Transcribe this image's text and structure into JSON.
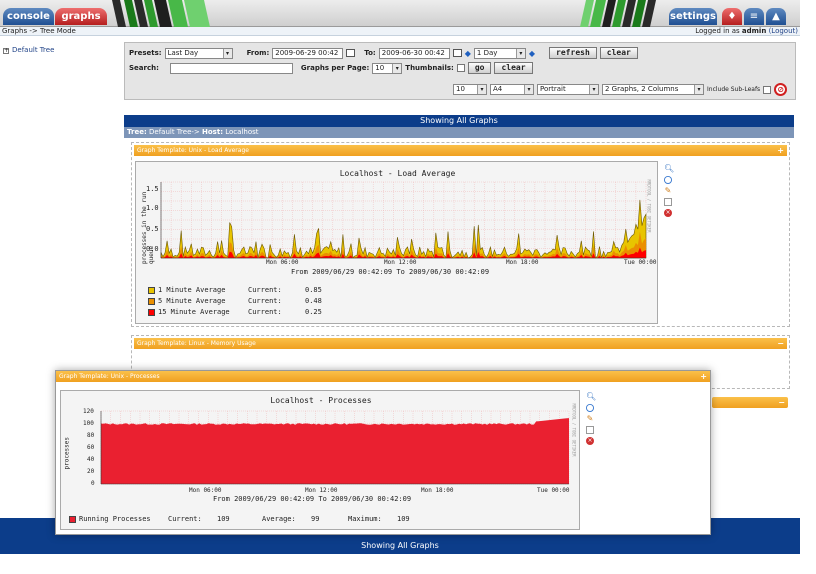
{
  "tabs": {
    "console": "console",
    "graphs": "graphs",
    "settings": "settings"
  },
  "breadcrumb": "Graphs -> Tree Mode",
  "login": {
    "prefix": "Logged in as",
    "user": "admin",
    "logout": "(Logout)"
  },
  "tree": {
    "root_toggle": "+",
    "root_label": "Default Tree"
  },
  "filter": {
    "presets_label": "Presets:",
    "presets_value": "Last Day",
    "from_label": "From:",
    "from_value": "2009-06-29 00:42",
    "to_label": "To:",
    "to_value": "2009-06-30 00:42",
    "timespan_value": "1 Day",
    "refresh_label": "refresh",
    "clear_label": "clear",
    "search_label": "Search:",
    "search_value": "",
    "graphs_per_page_label": "Graphs per Page:",
    "graphs_per_page_value": "10",
    "thumbnails_label": "Thumbnails:",
    "go_label": "go",
    "clear2_label": "clear",
    "pdf_count": "10",
    "pdf_paper": "A4",
    "pdf_orientation": "Portrait",
    "pdf_layout": "2 Graphs, 2 Columns",
    "include_subleafs_label": "Include Sub-Leafs"
  },
  "showing_all": "Showing All Graphs",
  "tree_host": {
    "tree_label": "Tree:",
    "tree_value": "Default Tree->",
    "host_label": "Host:",
    "host_value": "Localhost"
  },
  "panels": {
    "load": {
      "title": "Graph Template: Unix - Load Average"
    },
    "memory": {
      "title": "Graph Template: Linux - Memory Usage"
    },
    "processes": {
      "title": "Graph Template: Unix - Processes"
    }
  },
  "load_graph": {
    "title": "Localhost - Load Average",
    "ylabel": "processes in the run queue",
    "yticks": [
      "1.5",
      "1.0",
      "0.5",
      "0.0"
    ],
    "xticks": [
      "Mon 06:00",
      "Mon 12:00",
      "Mon 18:00",
      "Tue 00:00"
    ],
    "range": "From 2009/06/29 00:42:09 To 2009/06/30 00:42:09",
    "side_label": "RRDTOOL / TOBI OETIKER",
    "legend": [
      {
        "label": "1 Minute Average",
        "current_label": "Current:",
        "current": "0.85",
        "color": "#e8c400"
      },
      {
        "label": "5 Minute Average",
        "current_label": "Current:",
        "current": "0.48",
        "color": "#ea8f00"
      },
      {
        "label": "15 Minute Average",
        "current_label": "Current:",
        "current": "0.25",
        "color": "#ff0000"
      }
    ]
  },
  "proc_graph": {
    "title": "Localhost - Processes",
    "ylabel": "processes",
    "yticks": [
      "120",
      "100",
      "80",
      "60",
      "40",
      "20",
      "0"
    ],
    "xticks": [
      "Mon 06:00",
      "Mon 12:00",
      "Mon 18:00",
      "Tue 00:00"
    ],
    "range": "From 2009/06/29 00:42:09 To 2009/06/30 00:42:09",
    "side_label": "RRDTOOL / TOBI OETIKER",
    "legend": {
      "label": "Running Processes",
      "current_label": "Current:",
      "current": "109",
      "average_label": "Average:",
      "average": "99",
      "maximum_label": "Maximum:",
      "maximum": "109",
      "color": "#ea2030"
    }
  },
  "colors": {
    "brand_blue": "#0c3d8a",
    "panel_orange": "#f0a020",
    "console_tab": "#1f4f92",
    "graphs_tab": "#b51f1f"
  },
  "icons": [
    "zoom-icon",
    "realtime-icon",
    "edit-icon",
    "blank-icon",
    "delete-icon"
  ]
}
